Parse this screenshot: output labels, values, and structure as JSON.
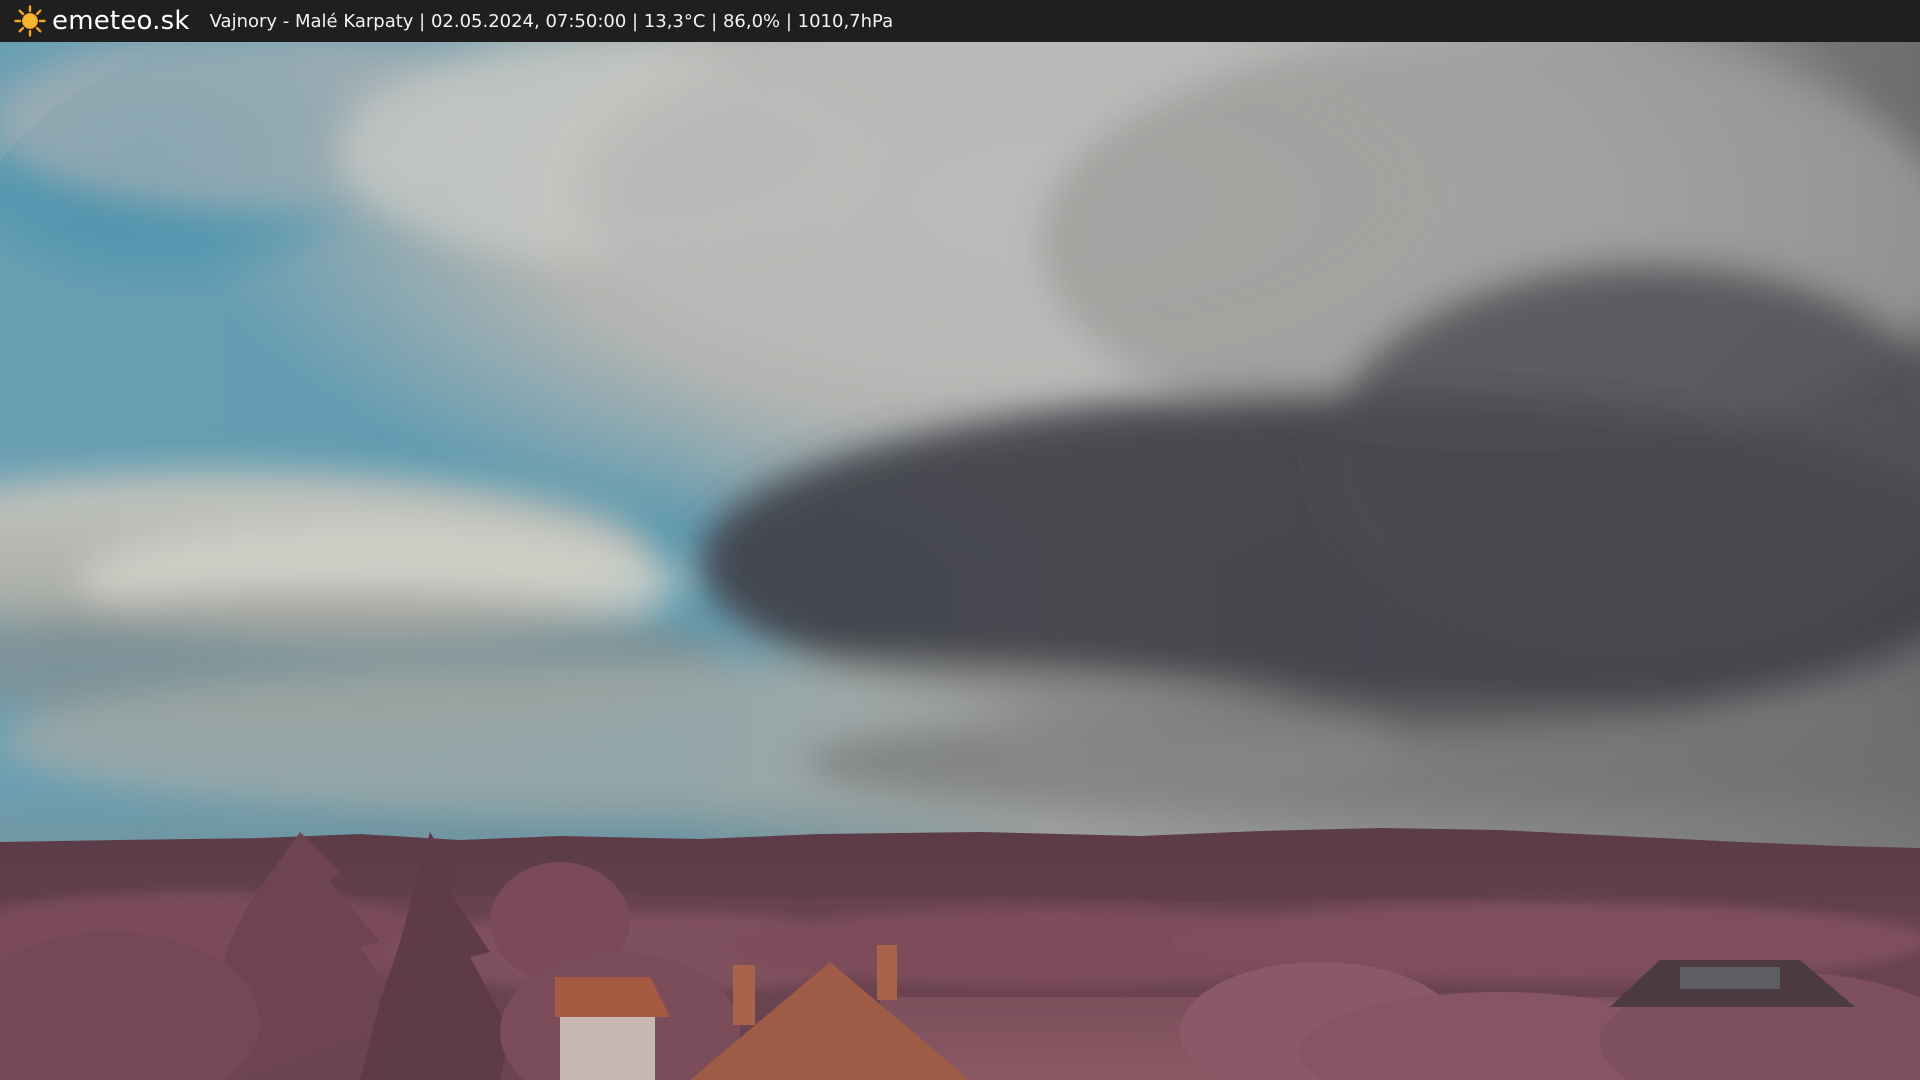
{
  "header": {
    "brand": "emeteo.sk",
    "caption": "Vajnory - Malé Karpaty | 02.05.2024, 07:50:00 | 13,3°C | 86,0% | 1010,7hPa",
    "logo_icon": "sun-icon"
  },
  "colors": {
    "bar": "#1f1f1f",
    "sky_blue": "#4f93ad",
    "cloud_light": "#d8d8d0",
    "cloud_dark": "#4a4a4e",
    "hills": "#5a3b45",
    "foliage": "#8a5a68",
    "roof": "#a85a42"
  }
}
